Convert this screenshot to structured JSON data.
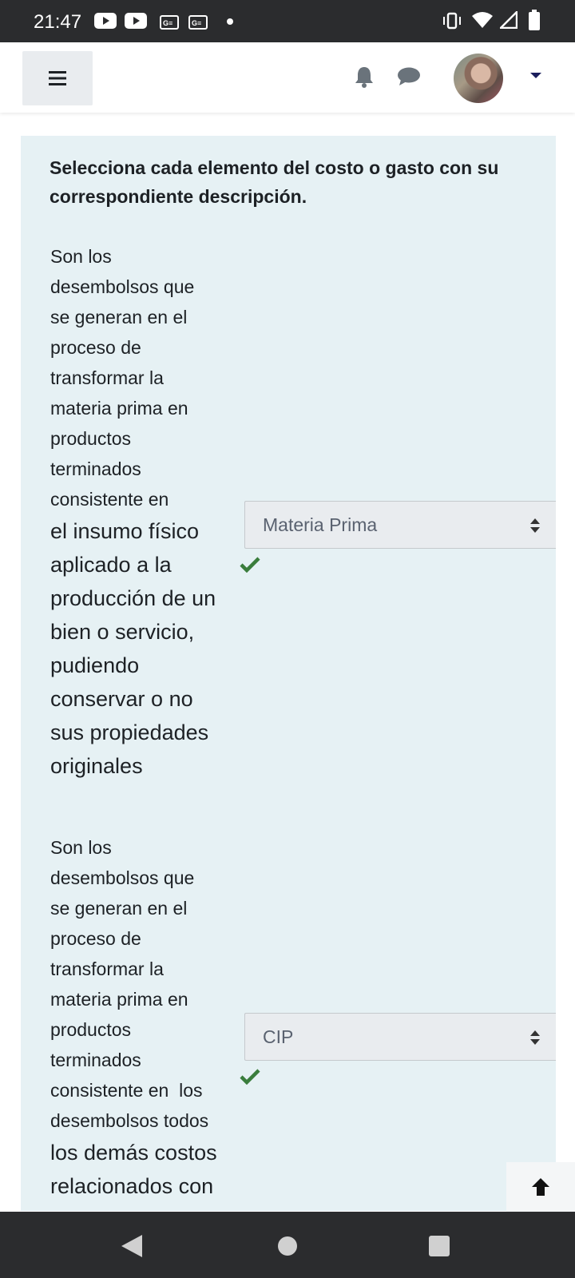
{
  "status_bar": {
    "time": "21:47",
    "left_icons": [
      "youtube-icon",
      "youtube-icon",
      "news-icon",
      "news-icon",
      "dot-icon"
    ],
    "right_icons": [
      "vibrate-icon",
      "wifi-icon",
      "signal-icon",
      "battery-icon"
    ]
  },
  "navbar": {
    "menu_icon": "hamburger-menu-icon",
    "notifications_icon": "bell-icon",
    "messages_icon": "chat-bubble-icon",
    "user_menu_icon": "caret-down-icon"
  },
  "question": {
    "prompt": "Selecciona cada elemento del costo o gasto con su correspondiente descripción.",
    "items": [
      {
        "stem_small": "Son los\ndesembolsos que\nse generan en el\nproceso de\ntransformar la\nmateria prima en\nproductos\nterminados\nconsistente en",
        "stem_large": "el insumo físico\naplicado a la\nproducción de un\nbien o servicio,\npudiendo\nconservar o no\nsus propiedades\noriginales",
        "selected": "Materia Prima",
        "result_icon": "check-icon"
      },
      {
        "stem_small": "Son los\ndesembolsos que\nse generan en el\nproceso de\ntransformar la\nmateria prima en\nproductos\nterminados\nconsistente en  los\ndesembolsos todos",
        "stem_large": "los demás costos\nrelacionados con",
        "selected": "CIP",
        "result_icon": "check-icon"
      }
    ]
  },
  "back_to_top_icon": "arrow-up-icon",
  "system_nav": [
    "back-icon",
    "home-icon",
    "recents-icon"
  ],
  "colors": {
    "status_bar": "#2b2c2e",
    "panel_bg": "#e6f1f4",
    "check": "#3a7d3c",
    "caret": "#1b1e5c"
  }
}
